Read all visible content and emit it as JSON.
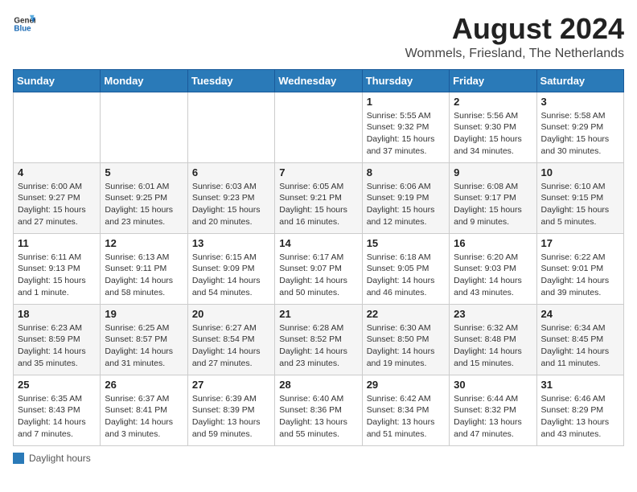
{
  "header": {
    "logo_general": "General",
    "logo_blue": "Blue",
    "month_title": "August 2024",
    "location": "Wommels, Friesland, The Netherlands"
  },
  "weekdays": [
    "Sunday",
    "Monday",
    "Tuesday",
    "Wednesday",
    "Thursday",
    "Friday",
    "Saturday"
  ],
  "legend": {
    "label": "Daylight hours"
  },
  "weeks": [
    {
      "days": [
        {
          "num": "",
          "info": ""
        },
        {
          "num": "",
          "info": ""
        },
        {
          "num": "",
          "info": ""
        },
        {
          "num": "",
          "info": ""
        },
        {
          "num": "1",
          "info": "Sunrise: 5:55 AM\nSunset: 9:32 PM\nDaylight: 15 hours and 37 minutes."
        },
        {
          "num": "2",
          "info": "Sunrise: 5:56 AM\nSunset: 9:30 PM\nDaylight: 15 hours and 34 minutes."
        },
        {
          "num": "3",
          "info": "Sunrise: 5:58 AM\nSunset: 9:29 PM\nDaylight: 15 hours and 30 minutes."
        }
      ]
    },
    {
      "days": [
        {
          "num": "4",
          "info": "Sunrise: 6:00 AM\nSunset: 9:27 PM\nDaylight: 15 hours and 27 minutes."
        },
        {
          "num": "5",
          "info": "Sunrise: 6:01 AM\nSunset: 9:25 PM\nDaylight: 15 hours and 23 minutes."
        },
        {
          "num": "6",
          "info": "Sunrise: 6:03 AM\nSunset: 9:23 PM\nDaylight: 15 hours and 20 minutes."
        },
        {
          "num": "7",
          "info": "Sunrise: 6:05 AM\nSunset: 9:21 PM\nDaylight: 15 hours and 16 minutes."
        },
        {
          "num": "8",
          "info": "Sunrise: 6:06 AM\nSunset: 9:19 PM\nDaylight: 15 hours and 12 minutes."
        },
        {
          "num": "9",
          "info": "Sunrise: 6:08 AM\nSunset: 9:17 PM\nDaylight: 15 hours and 9 minutes."
        },
        {
          "num": "10",
          "info": "Sunrise: 6:10 AM\nSunset: 9:15 PM\nDaylight: 15 hours and 5 minutes."
        }
      ]
    },
    {
      "days": [
        {
          "num": "11",
          "info": "Sunrise: 6:11 AM\nSunset: 9:13 PM\nDaylight: 15 hours and 1 minute."
        },
        {
          "num": "12",
          "info": "Sunrise: 6:13 AM\nSunset: 9:11 PM\nDaylight: 14 hours and 58 minutes."
        },
        {
          "num": "13",
          "info": "Sunrise: 6:15 AM\nSunset: 9:09 PM\nDaylight: 14 hours and 54 minutes."
        },
        {
          "num": "14",
          "info": "Sunrise: 6:17 AM\nSunset: 9:07 PM\nDaylight: 14 hours and 50 minutes."
        },
        {
          "num": "15",
          "info": "Sunrise: 6:18 AM\nSunset: 9:05 PM\nDaylight: 14 hours and 46 minutes."
        },
        {
          "num": "16",
          "info": "Sunrise: 6:20 AM\nSunset: 9:03 PM\nDaylight: 14 hours and 43 minutes."
        },
        {
          "num": "17",
          "info": "Sunrise: 6:22 AM\nSunset: 9:01 PM\nDaylight: 14 hours and 39 minutes."
        }
      ]
    },
    {
      "days": [
        {
          "num": "18",
          "info": "Sunrise: 6:23 AM\nSunset: 8:59 PM\nDaylight: 14 hours and 35 minutes."
        },
        {
          "num": "19",
          "info": "Sunrise: 6:25 AM\nSunset: 8:57 PM\nDaylight: 14 hours and 31 minutes."
        },
        {
          "num": "20",
          "info": "Sunrise: 6:27 AM\nSunset: 8:54 PM\nDaylight: 14 hours and 27 minutes."
        },
        {
          "num": "21",
          "info": "Sunrise: 6:28 AM\nSunset: 8:52 PM\nDaylight: 14 hours and 23 minutes."
        },
        {
          "num": "22",
          "info": "Sunrise: 6:30 AM\nSunset: 8:50 PM\nDaylight: 14 hours and 19 minutes."
        },
        {
          "num": "23",
          "info": "Sunrise: 6:32 AM\nSunset: 8:48 PM\nDaylight: 14 hours and 15 minutes."
        },
        {
          "num": "24",
          "info": "Sunrise: 6:34 AM\nSunset: 8:45 PM\nDaylight: 14 hours and 11 minutes."
        }
      ]
    },
    {
      "days": [
        {
          "num": "25",
          "info": "Sunrise: 6:35 AM\nSunset: 8:43 PM\nDaylight: 14 hours and 7 minutes."
        },
        {
          "num": "26",
          "info": "Sunrise: 6:37 AM\nSunset: 8:41 PM\nDaylight: 14 hours and 3 minutes."
        },
        {
          "num": "27",
          "info": "Sunrise: 6:39 AM\nSunset: 8:39 PM\nDaylight: 13 hours and 59 minutes."
        },
        {
          "num": "28",
          "info": "Sunrise: 6:40 AM\nSunset: 8:36 PM\nDaylight: 13 hours and 55 minutes."
        },
        {
          "num": "29",
          "info": "Sunrise: 6:42 AM\nSunset: 8:34 PM\nDaylight: 13 hours and 51 minutes."
        },
        {
          "num": "30",
          "info": "Sunrise: 6:44 AM\nSunset: 8:32 PM\nDaylight: 13 hours and 47 minutes."
        },
        {
          "num": "31",
          "info": "Sunrise: 6:46 AM\nSunset: 8:29 PM\nDaylight: 13 hours and 43 minutes."
        }
      ]
    }
  ]
}
